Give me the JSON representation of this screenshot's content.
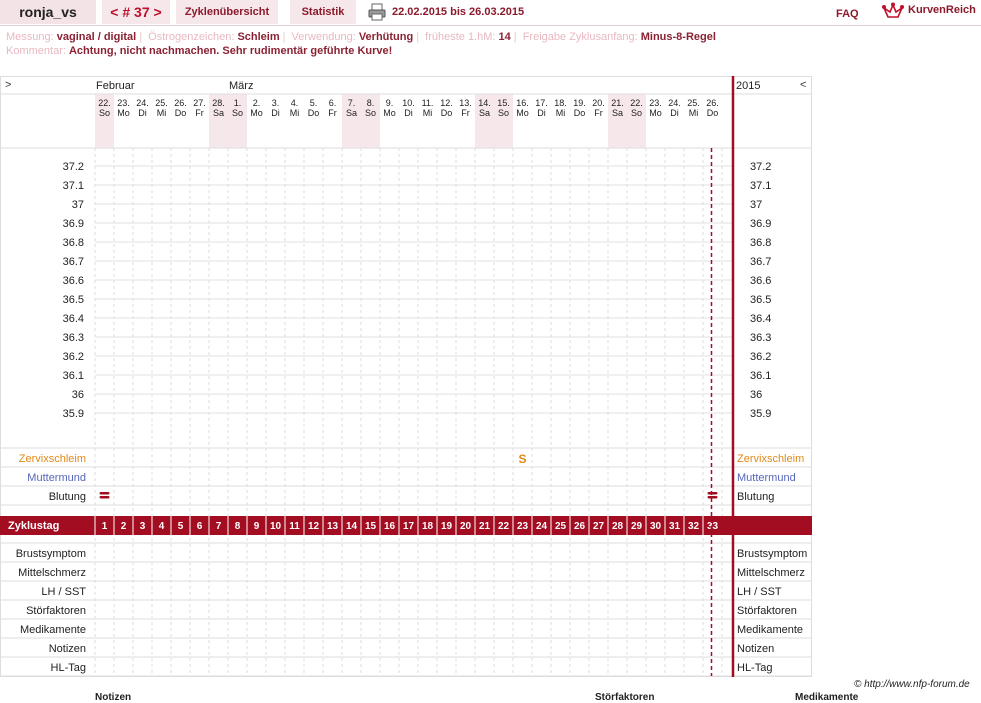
{
  "header": {
    "user": "ronja_vs",
    "cycle_prev": "<",
    "cycle_label": "# 37",
    "cycle_next": ">",
    "tab_overview": "Zyklenübersicht",
    "tab_stats": "Statistik",
    "print_icon": "printer-icon",
    "date_range": "22.02.2015 bis 26.03.2015",
    "faq": "FAQ",
    "logo_text": "KurvenReich",
    "logo_icon": "crown-icon"
  },
  "info": {
    "messung_label": "Messung:",
    "messung_value": "vaginal / digital",
    "oestrogen_label": "Östrogenzeichen:",
    "oestrogen_value": "Schleim",
    "verwendung_label": "Verwendung:",
    "verwendung_value": "Verhütung",
    "frueheste_label": "früheste 1.hM:",
    "frueheste_value": "14",
    "freigabe_label": "Freigabe Zyklusanfang:",
    "freigabe_value": "Minus-8-Regel",
    "kommentar_label": "Kommentar:",
    "kommentar_value": "Achtung, nicht nachmachen. Sehr rudimentär geführte Kurve!"
  },
  "chart_data": {
    "type": "table",
    "nav_left": ">",
    "nav_right": "<",
    "month_feb": "Februar",
    "month_mar": "März",
    "year": "2015",
    "dates": [
      "22.",
      "23.",
      "24.",
      "25.",
      "26.",
      "27.",
      "28.",
      "1.",
      "2.",
      "3.",
      "4.",
      "5.",
      "6.",
      "7.",
      "8.",
      "9.",
      "10.",
      "11.",
      "12.",
      "13.",
      "14.",
      "15.",
      "16.",
      "17.",
      "18.",
      "19.",
      "20.",
      "21.",
      "22.",
      "23.",
      "24.",
      "25.",
      "26."
    ],
    "weekdays": [
      "So",
      "Mo",
      "Di",
      "Mi",
      "Do",
      "Fr",
      "Sa",
      "So",
      "Mo",
      "Di",
      "Mi",
      "Do",
      "Fr",
      "Sa",
      "So",
      "Mo",
      "Di",
      "Mi",
      "Do",
      "Fr",
      "Sa",
      "So",
      "Mo",
      "Di",
      "Mi",
      "Do",
      "Fr",
      "Sa",
      "So",
      "Mo",
      "Di",
      "Mi",
      "Do"
    ],
    "temp_axis": [
      "37.2",
      "37.1",
      "37",
      "36.9",
      "36.8",
      "36.7",
      "36.6",
      "36.5",
      "36.4",
      "36.3",
      "36.2",
      "36.1",
      "36",
      "35.9"
    ],
    "rows_top": [
      "Zervixschleim",
      "Muttermund",
      "Blutung"
    ],
    "cycle_row_label": "Zyklustag",
    "cycle_days": [
      "1",
      "2",
      "3",
      "4",
      "5",
      "6",
      "7",
      "8",
      "9",
      "10",
      "11",
      "12",
      "13",
      "14",
      "15",
      "16",
      "17",
      "18",
      "19",
      "20",
      "21",
      "22",
      "23",
      "24",
      "25",
      "26",
      "27",
      "28",
      "29",
      "30",
      "31",
      "32",
      "33"
    ],
    "rows_bottom": [
      "Brustsymptom",
      "Mittelschmerz",
      "LH / SST",
      "Störfaktoren",
      "Medikamente",
      "Notizen",
      "HL-Tag"
    ],
    "cervix_day": 23,
    "cervix_symbol": "S",
    "bleeding_days": [
      1,
      33
    ],
    "cycle_end_day": 33,
    "colors": {
      "accent": "#a30d22",
      "weekend": "#f6e7ea",
      "cervix": "#e08a1a",
      "muttermund": "#5566bb"
    }
  },
  "footer": {
    "copyright": "© http://www.nfp-forum.de",
    "bottom_notizen": "Notizen",
    "bottom_stoerfaktoren": "Störfaktoren",
    "bottom_medikamente": "Medikamente"
  }
}
